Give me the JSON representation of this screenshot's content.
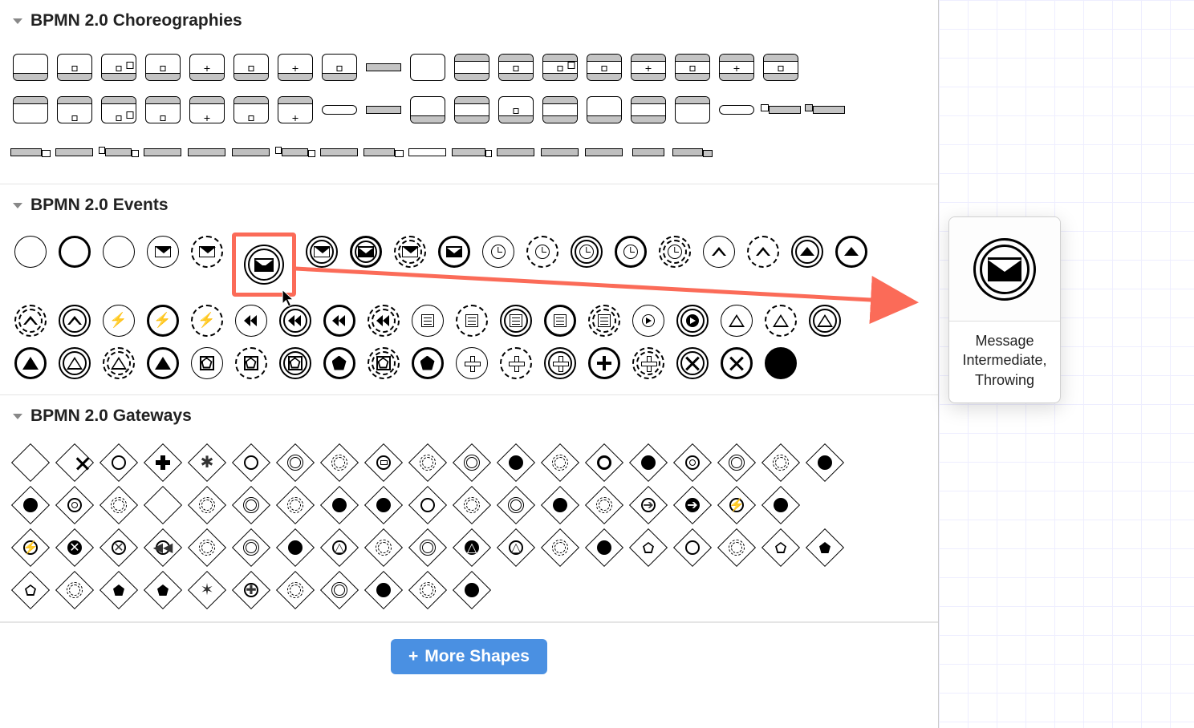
{
  "sections": {
    "choreographies": {
      "title": "BPMN 2.0 Choreographies"
    },
    "events": {
      "title": "BPMN 2.0 Events"
    },
    "gateways": {
      "title": "BPMN 2.0 Gateways"
    }
  },
  "tooltip": {
    "label": "Message Intermediate, Throwing"
  },
  "more_shapes_button": "More Shapes",
  "highlighted_event": "message-intermediate-throwing",
  "accent_color": "#fb6b58",
  "primary_button_color": "#4a90e2",
  "choreography_shapes": {
    "row1_count": 18,
    "row2_count": 19,
    "row3_count": 16
  },
  "event_shapes": {
    "row1": [
      "none-start",
      "none-intermediate",
      "none-end",
      "message-start",
      "message-start-ni",
      "message-intermediate-throwing",
      "message-intermediate-catching",
      "message-boundary",
      "message-boundary-ni",
      "message-end",
      "timer-start",
      "timer-start-ni",
      "timer-intermediate",
      "timer-boundary",
      "timer-boundary-ni",
      "escalation-start",
      "escalation-start-ni",
      "escalation-intermediate-throwing",
      "escalation-boundary"
    ],
    "row2": [
      "escalation-boundary-ni",
      "escalation-end",
      "conditional-start",
      "conditional-start-ni",
      "conditional-intermediate",
      "compensation-start",
      "compensation-intermediate",
      "compensation-boundary",
      "compensation-end",
      "rule-start",
      "rule-start-ni",
      "rule-intermediate",
      "rule-boundary",
      "rule-boundary-ni",
      "link-catch",
      "link-throw",
      "signal-start",
      "signal-start-ni",
      "signal-intermediate-catching"
    ],
    "row3": [
      "signal-intermediate-throwing",
      "signal-boundary",
      "signal-boundary-ni",
      "signal-end",
      "multiple-start",
      "multiple-start-ni",
      "multiple-intermediate-catching",
      "multiple-intermediate-throwing",
      "multiple-boundary",
      "multiple-boundary-ni",
      "multiple-end",
      "parallel-start",
      "parallel-start-ni",
      "parallel-intermediate",
      "parallel-boundary",
      "parallel-boundary-ni",
      "cancel-intermediate",
      "cancel-end",
      "terminate-end"
    ]
  },
  "gateway_shapes": {
    "row1": [
      "exclusive",
      "exclusive-marker",
      "inclusive",
      "parallel",
      "complex",
      "event-based-start",
      "event-based-intermediate",
      "event-based",
      "message-start",
      "message-start-dashed",
      "message-intermediate",
      "message-dbl",
      "message-dbl-filled",
      "message-dbl-dashed",
      "timer",
      "timer-dashed",
      "timer-dbl",
      "timer-dbl-dashed",
      "timer-dbl-filled"
    ],
    "row2": [
      "gw1",
      "gw2",
      "gw3",
      "gw4",
      "gw5",
      "gw6",
      "gw7",
      "gw8",
      "gw9",
      "gw10",
      "gw11",
      "gw12",
      "gw13",
      "gw14",
      "gw15",
      "gw16",
      "gw17",
      "gw18",
      "gw19"
    ],
    "row3": [
      "gw20",
      "gw21",
      "gw22",
      "gw23",
      "gw24",
      "gw25",
      "gw26",
      "gw27",
      "gw28",
      "gw29",
      "gw30",
      "gw31",
      "gw32",
      "gw33",
      "gw34",
      "gw35",
      "gw36",
      "gw37",
      "gw38"
    ],
    "row4": [
      "gw39",
      "gw40",
      "gw41",
      "gw42",
      "gw43",
      "gw44",
      "gw45",
      "gw46",
      "gw47",
      "gw48",
      "gw49",
      "gw50"
    ]
  }
}
